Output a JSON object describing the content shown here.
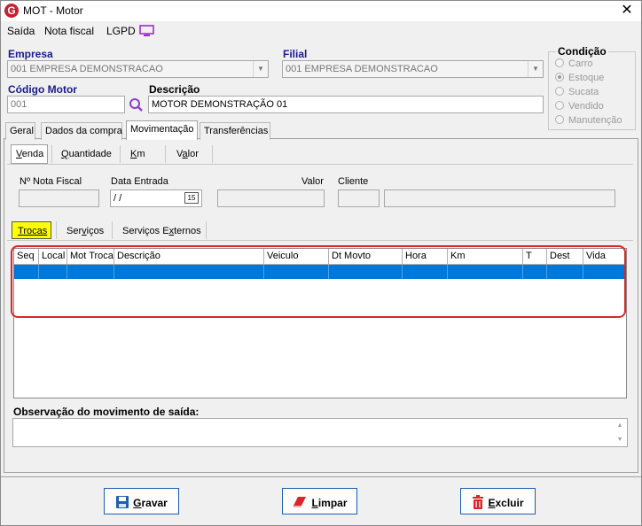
{
  "window": {
    "title": "MOT - Motor",
    "app_icon_letter": "G",
    "close_glyph": "✕"
  },
  "menu": {
    "items": [
      "Saída",
      "Nota fiscal",
      "LGPD"
    ]
  },
  "empresa": {
    "label": "Empresa",
    "value": "001 EMPRESA DEMONSTRACAO"
  },
  "filial": {
    "label": "Filial",
    "value": "001 EMPRESA DEMONSTRACAO"
  },
  "codigo": {
    "label": "Código Motor",
    "value": "001"
  },
  "descricao": {
    "label": "Descrição",
    "value": "MOTOR DEMONSTRAÇÃO 01"
  },
  "condicao": {
    "label": "Condição",
    "options": [
      "Carro",
      "Estoque",
      "Sucata",
      "Vendido",
      "Manutenção"
    ],
    "selected_index": 1
  },
  "tabs": {
    "items": [
      "Geral",
      "Dados da compra",
      "Movimentação",
      "Transferências"
    ],
    "active_index": 2
  },
  "sub_tabs": {
    "venda": {
      "label_u": "V",
      "label_rest": "enda"
    },
    "quantidade": {
      "label_u": "Q",
      "label_rest": "uantidade"
    },
    "km": {
      "label_u": "K",
      "label_rest": "m"
    },
    "valor": {
      "label_pre": "V",
      "label_u": "a",
      "label_rest": "lor"
    }
  },
  "venda_fields": {
    "nota_fiscal": "Nº Nota Fiscal",
    "data_entrada": "Data Entrada",
    "data_value": " / /",
    "valor": "Valor",
    "cliente": "Cliente"
  },
  "inner_tabs": {
    "trocas": {
      "label_u": "T",
      "label_rest": "rocas"
    },
    "servicos": {
      "label_pre": "Ser",
      "label_u": "v",
      "label_rest": "iços"
    },
    "externos": {
      "label_pre": "Serviços E",
      "label_u": "x",
      "label_rest": "ternos"
    }
  },
  "grid": {
    "columns": [
      "Seq",
      "Local",
      "Mot Troca",
      "Descrição",
      "Veiculo",
      "Dt Movto",
      "Hora",
      "Km",
      "T",
      "Dest",
      "Vida"
    ]
  },
  "observacao": {
    "label": "Observação do movimento de saída:",
    "value": ""
  },
  "buttons": {
    "gravar": {
      "label_u": "G",
      "label_rest": "ravar"
    },
    "limpar": {
      "label_u": "L",
      "label_rest": "impar"
    },
    "excluir": {
      "label_u": "E",
      "label_rest": "xcluir"
    }
  },
  "colors": {
    "accent": "#0078d7",
    "label_blue": "#1a1a8c",
    "highlight": "#d9262b",
    "active_subtab": "#ffff00"
  }
}
